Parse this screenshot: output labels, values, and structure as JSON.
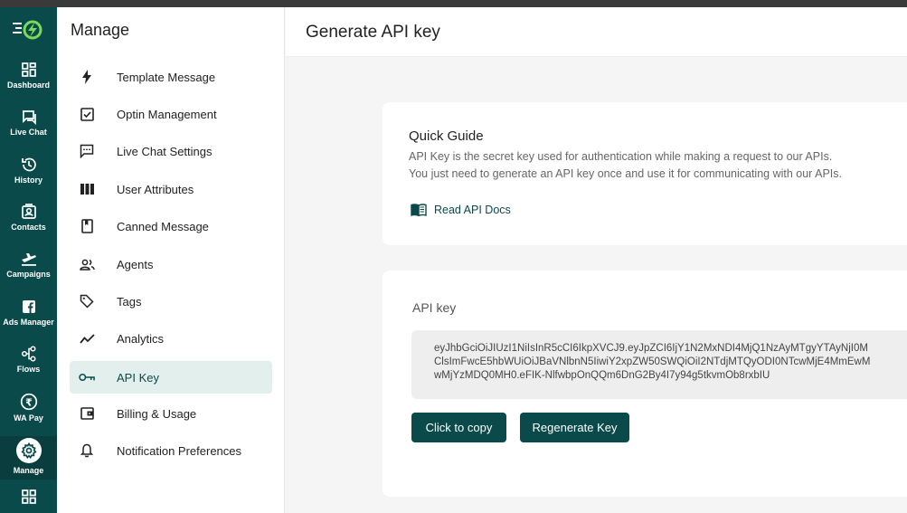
{
  "rail": {
    "items": [
      {
        "label": "Dashboard",
        "icon": "dashboard-icon"
      },
      {
        "label": "Live Chat",
        "icon": "live-chat-icon"
      },
      {
        "label": "History",
        "icon": "history-icon"
      },
      {
        "label": "Contacts",
        "icon": "contacts-icon"
      },
      {
        "label": "Campaigns",
        "icon": "campaigns-icon"
      },
      {
        "label": "Ads Manager",
        "icon": "ads-manager-icon"
      },
      {
        "label": "Flows",
        "icon": "flows-icon"
      },
      {
        "label": "WA Pay",
        "icon": "wa-pay-icon"
      },
      {
        "label": "Manage",
        "icon": "manage-icon",
        "active": true
      }
    ]
  },
  "manage": {
    "title": "Manage",
    "items": [
      {
        "label": "Template Message",
        "icon": "lightning-icon"
      },
      {
        "label": "Optin Management",
        "icon": "checkbox-icon"
      },
      {
        "label": "Live Chat Settings",
        "icon": "chat-dots-icon"
      },
      {
        "label": "User Attributes",
        "icon": "columns-icon"
      },
      {
        "label": "Canned Message",
        "icon": "bookmark-icon"
      },
      {
        "label": "Agents",
        "icon": "agents-icon"
      },
      {
        "label": "Tags",
        "icon": "tag-icon"
      },
      {
        "label": "Analytics",
        "icon": "analytics-icon"
      },
      {
        "label": "API Key",
        "icon": "key-icon",
        "active": true
      },
      {
        "label": "Billing & Usage",
        "icon": "wallet-icon"
      },
      {
        "label": "Notification Preferences",
        "icon": "bell-icon"
      }
    ]
  },
  "header": {
    "title": "Generate API key"
  },
  "quick_guide": {
    "title": "Quick Guide",
    "line1": "API Key is the secret key used for authentication while making a request to our APIs.",
    "line2": "You just need to generate an API key once and use it for communicating with our APIs.",
    "docs_link": "Read API Docs"
  },
  "api_key": {
    "label": "API key",
    "value": "eyJhbGciOiJIUzI1NiIsInR5cCI6IkpXVCJ9.eyJpZCI6IjY1N2MxNDI4MjQ1NzAyMTgyYTAyNjI0M\nClsImFwcE5hbWUiOiJBaVNlbnN5IiwiY2xpZW50SWQiOiI2NTdjMTQyODI0NTcwMjE4MmEwM\nwMjYzMDQ0MH0.eFIK-NlfwbpOnQQm6DnG2By4I7y94g5tkvmOb8rxbIU",
    "copy_label": "Click to copy",
    "regen_label": "Regenerate Key"
  },
  "colors": {
    "brand": "#0b4a4a",
    "active_bg": "#e3efec"
  }
}
